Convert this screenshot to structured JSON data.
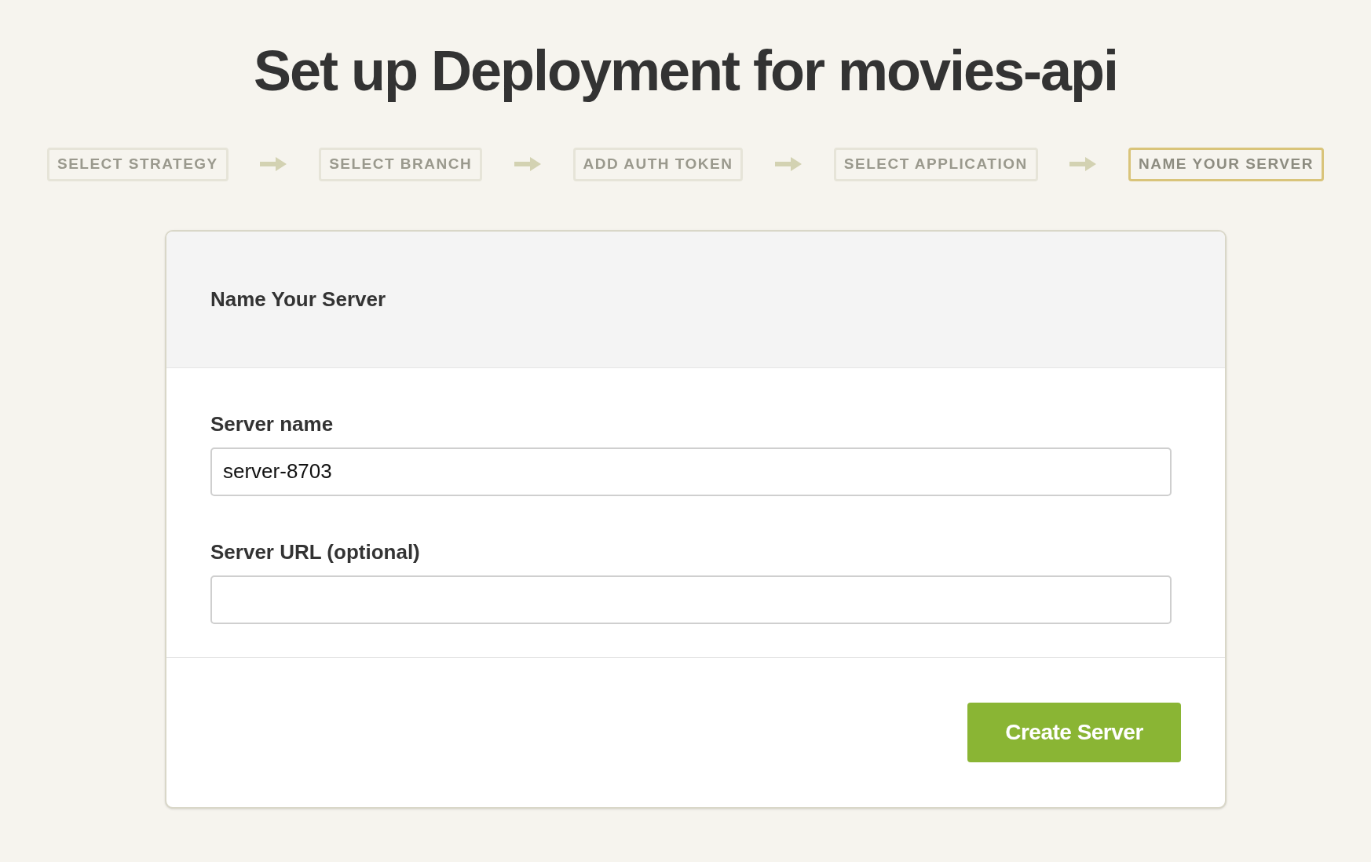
{
  "title": "Set up Deployment for movies-api",
  "steps": [
    {
      "label": "SELECT STRATEGY",
      "selected": false
    },
    {
      "label": "SELECT BRANCH",
      "selected": false
    },
    {
      "label": "ADD AUTH TOKEN",
      "selected": false
    },
    {
      "label": "SELECT APPLICATION",
      "selected": false
    },
    {
      "label": "NAME YOUR SERVER",
      "selected": true
    }
  ],
  "card": {
    "heading": "Name Your Server",
    "fields": [
      {
        "label": "Server name",
        "value": "server-8703"
      },
      {
        "label": "Server URL (optional)"
      }
    ],
    "button": "Create Server"
  }
}
